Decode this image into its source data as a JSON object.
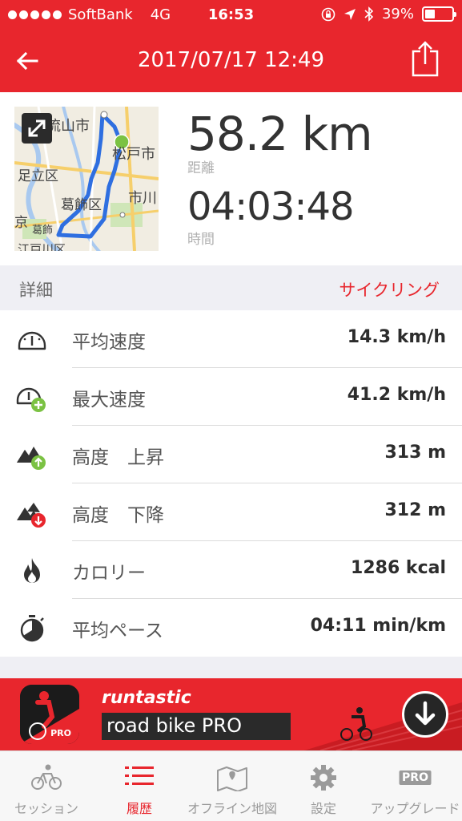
{
  "status_bar": {
    "carrier": "SoftBank",
    "network": "4G",
    "time": "16:53",
    "battery": "39%",
    "battery_level": 0.39
  },
  "nav": {
    "title": "2017/07/17 12:49",
    "back_icon": "arrow-left-icon",
    "share_icon": "share-icon"
  },
  "summary": {
    "map_labels": [
      "流山市",
      "松戸市",
      "足立区",
      "葛飾区",
      "市川",
      "京",
      "葛飾",
      "江戸川区"
    ],
    "distance_value": "58.2 km",
    "distance_label": "距離",
    "duration_value": "04:03:48",
    "duration_label": "時間"
  },
  "section": {
    "title": "詳細",
    "activity": "サイクリング"
  },
  "details": [
    {
      "icon": "speedometer-icon",
      "label": "平均速度",
      "value": "14.3 km/h"
    },
    {
      "icon": "max-speed-icon",
      "label": "最大速度",
      "value": "41.2 km/h"
    },
    {
      "icon": "elevation-up-icon",
      "label": "高度　上昇",
      "value": "313 m"
    },
    {
      "icon": "elevation-down-icon",
      "label": "高度　下降",
      "value": "312 m"
    },
    {
      "icon": "flame-icon",
      "label": "カロリー",
      "value": "1286 kcal"
    },
    {
      "icon": "stopwatch-icon",
      "label": "平均ペース",
      "value": "04:11 min/km"
    }
  ],
  "banner": {
    "brand": "runtastic",
    "product": "road bike PRO",
    "pro_badge": "PRO"
  },
  "tabs": [
    {
      "label": "セッション",
      "icon": "cyclist-icon",
      "active": false
    },
    {
      "label": "履歴",
      "icon": "list-icon",
      "active": true
    },
    {
      "label": "オフライン地図",
      "icon": "map-pin-icon",
      "active": false
    },
    {
      "label": "設定",
      "icon": "gear-icon",
      "active": false
    },
    {
      "label": "アップグレード",
      "icon": "pro-icon",
      "icon_text": "PRO",
      "active": false
    }
  ],
  "colors": {
    "accent": "#e8262d",
    "route": "#2f6fe0",
    "green_badge": "#7bc243",
    "red_badge": "#e8262d"
  }
}
